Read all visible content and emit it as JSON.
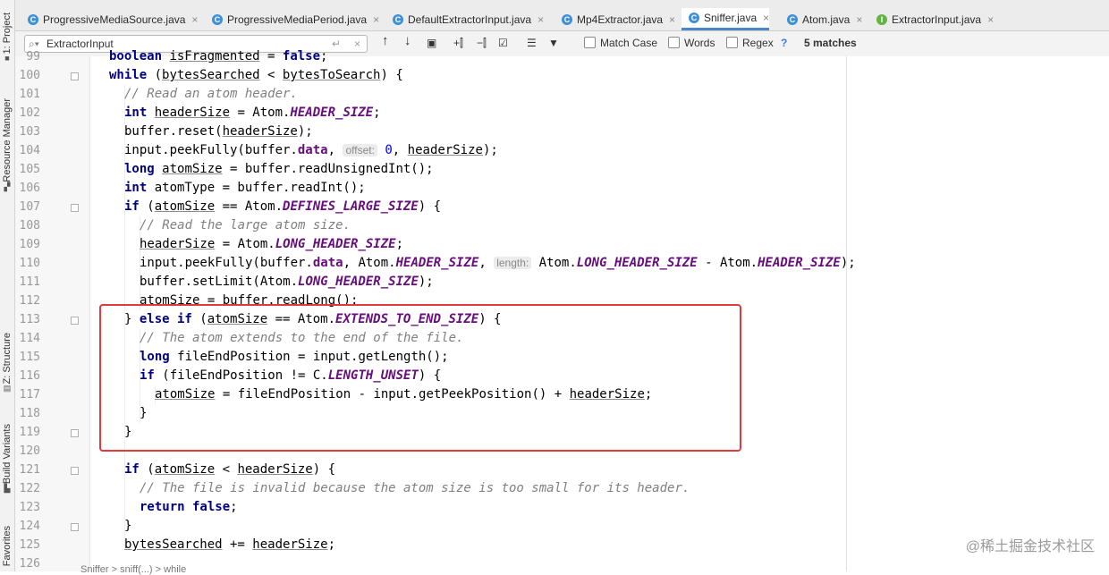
{
  "sidebar": {
    "project": "1: Project",
    "resource_manager": "Resource Manager",
    "structure": "Z: Structure",
    "build_variants": "Build Variants",
    "favorites": "Favorites"
  },
  "tabs": [
    {
      "label": "ProgressiveMediaSource.java",
      "icon": "C",
      "active": false
    },
    {
      "label": "ProgressiveMediaPeriod.java",
      "icon": "C",
      "active": false
    },
    {
      "label": "DefaultExtractorInput.java",
      "icon": "C",
      "active": false
    },
    {
      "label": "Mp4Extractor.java",
      "icon": "C",
      "active": false
    },
    {
      "label": "Sniffer.java",
      "icon": "C",
      "active": true
    },
    {
      "label": "Atom.java",
      "icon": "C",
      "active": false
    },
    {
      "label": "ExtractorInput.java",
      "icon": "I",
      "active": false
    }
  ],
  "find": {
    "query": "ExtractorInput",
    "match_case": "Match Case",
    "words": "Words",
    "regex": "Regex",
    "help": "?",
    "matches": "5 matches"
  },
  "line_numbers": [
    "99",
    "100",
    "101",
    "102",
    "103",
    "104",
    "105",
    "106",
    "107",
    "108",
    "109",
    "110",
    "111",
    "112",
    "113",
    "114",
    "115",
    "116",
    "117",
    "118",
    "119",
    "120",
    "121",
    "122",
    "123",
    "124",
    "125",
    "126"
  ],
  "code": {
    "l099_a": "boolean ",
    "l099_b": "isFragmented",
    "l099_c": " = ",
    "l099_d": "false",
    "l099_e": ";",
    "l100_a": "while",
    "l100_b": " (",
    "l100_c": "bytesSearched",
    "l100_d": " < ",
    "l100_e": "bytesToSearch",
    "l100_f": ") {",
    "l101": "// Read an atom header.",
    "l102_a": "int ",
    "l102_b": "headerSize",
    "l102_c": " = Atom.",
    "l102_d": "HEADER_SIZE",
    "l102_e": ";",
    "l103_a": "buffer.reset(",
    "l103_b": "headerSize",
    "l103_c": ");",
    "l104_a": "input.peekFully(buffer.",
    "l104_b": "data",
    "l104_c": ", ",
    "l104_hint": "offset:",
    "l104_d": " ",
    "l104_e": "0",
    "l104_f": ", ",
    "l104_g": "headerSize",
    "l104_h": ");",
    "l105_a": "long ",
    "l105_b": "atomSize",
    "l105_c": " = buffer.readUnsignedInt();",
    "l106_a": "int ",
    "l106_b": "atomType = buffer.readInt();",
    "l107_a": "if",
    "l107_b": " (",
    "l107_c": "atomSize",
    "l107_d": " == Atom.",
    "l107_e": "DEFINES_LARGE_SIZE",
    "l107_f": ") {",
    "l108": "// Read the large atom size.",
    "l109_a": "headerSize",
    "l109_b": " = Atom.",
    "l109_c": "LONG_HEADER_SIZE",
    "l109_d": ";",
    "l110_a": "input.peekFully(buffer.",
    "l110_b": "data",
    "l110_c": ", Atom.",
    "l110_d": "HEADER_SIZE",
    "l110_e": ", ",
    "l110_hint": "length:",
    "l110_f": " Atom.",
    "l110_g": "LONG_HEADER_SIZE",
    "l110_h": " - Atom.",
    "l110_i": "HEADER_SIZE",
    "l110_j": ");",
    "l111_a": "buffer.setLimit(Atom.",
    "l111_b": "LONG_HEADER_SIZE",
    "l111_c": ");",
    "l112_a": "atomSize",
    "l112_b": " = buffer.readLong();",
    "l113_a": "} ",
    "l113_b": "else if",
    "l113_c": " (",
    "l113_d": "atomSize",
    "l113_e": " == Atom.",
    "l113_f": "EXTENDS_TO_END_SIZE",
    "l113_g": ") {",
    "l114": "// The atom extends to the end of the file.",
    "l115_a": "long ",
    "l115_b": "fileEndPosition = input.getLength();",
    "l116_a": "if",
    "l116_b": " (fileEndPosition != C.",
    "l116_c": "LENGTH_UNSET",
    "l116_d": ") {",
    "l117_a": "atomSize",
    "l117_b": " = fileEndPosition - input.getPeekPosition() + ",
    "l117_c": "headerSize",
    "l117_d": ";",
    "l118": "}",
    "l119": "}",
    "l121_a": "if",
    "l121_b": " (",
    "l121_c": "atomSize",
    "l121_d": " < ",
    "l121_e": "headerSize",
    "l121_f": ") {",
    "l122": "// The file is invalid because the atom size is too small for its header.",
    "l123_a": "return false",
    "l123_b": ";",
    "l124": "}",
    "l125_a": "bytesSearched",
    "l125_b": " += ",
    "l125_c": "headerSize",
    "l125_d": ";"
  },
  "status_peek": "Sniffer > sniff(...) > while",
  "watermark": "@稀土掘金技术社区",
  "colors": {
    "keyword": "#000080",
    "comment": "#808080",
    "constant": "#660e7a",
    "number": "#0000ff",
    "highlight_box": "#e0393e",
    "active_tab_underline": "#4a86c8"
  }
}
